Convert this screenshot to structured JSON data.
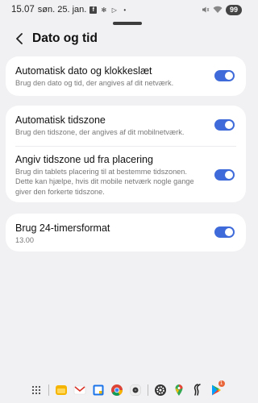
{
  "status_bar": {
    "time": "15.07",
    "date": "søn. 25. jan.",
    "battery": "99"
  },
  "header": {
    "title": "Dato og tid"
  },
  "sections": [
    {
      "items": [
        {
          "title": "Automatisk dato og klokkeslæt",
          "subtitle": "Brug den dato og tid, der angives af dit netværk.",
          "enabled": true
        }
      ]
    },
    {
      "items": [
        {
          "title": "Automatisk tidszone",
          "subtitle": "Brug den tidszone, der angives af dit mobilnetværk.",
          "enabled": true
        },
        {
          "title": "Angiv tidszone ud fra placering",
          "subtitle": "Brug din tablets placering til at bestemme tidszonen. Dette kan hjælpe, hvis dit mobile netværk nogle gange giver den forkerte tidszone.",
          "enabled": true
        }
      ]
    },
    {
      "items": [
        {
          "title": "Brug 24-timersformat",
          "subtitle": "13.00",
          "enabled": true
        }
      ]
    }
  ],
  "colors": {
    "accent": "#3e6bd9",
    "background": "#f1f1f3",
    "card": "#ffffff"
  },
  "dock": {
    "apps": [
      "apps-grid-icon",
      "files-icon",
      "gmail-icon",
      "calendar-icon",
      "chrome-icon",
      "camera-icon",
      "settings-icon",
      "maps-icon",
      "voice-icon",
      "play-store-icon"
    ],
    "play_store_badge": "1"
  }
}
